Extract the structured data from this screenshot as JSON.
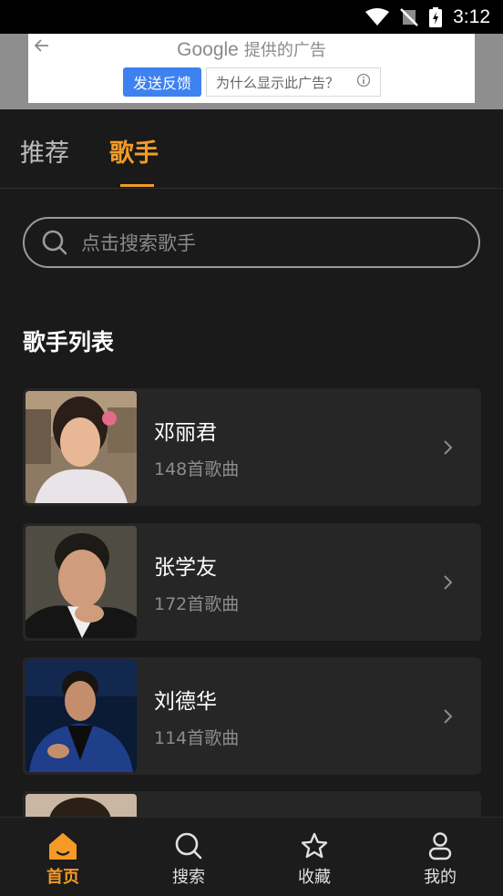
{
  "status_bar": {
    "time": "3:12"
  },
  "ad": {
    "brand": "Google",
    "title_suffix": "提供的广告",
    "feedback_label": "发送反馈",
    "why_label": "为什么显示此广告？"
  },
  "tabs": [
    {
      "label": "推荐",
      "active": false
    },
    {
      "label": "歌手",
      "active": true
    }
  ],
  "search": {
    "placeholder": "点击搜索歌手"
  },
  "section_title": "歌手列表",
  "singers": [
    {
      "name": "邓丽君",
      "count": "148首歌曲"
    },
    {
      "name": "张学友",
      "count": "172首歌曲"
    },
    {
      "name": "刘德华",
      "count": "114首歌曲"
    }
  ],
  "bottom_nav": [
    {
      "label": "首页",
      "icon": "home-icon",
      "active": true
    },
    {
      "label": "搜索",
      "icon": "search-icon",
      "active": false
    },
    {
      "label": "收藏",
      "icon": "star-icon",
      "active": false
    },
    {
      "label": "我的",
      "icon": "user-icon",
      "active": false
    }
  ],
  "colors": {
    "accent": "#f39b26",
    "background": "#1a1a1a",
    "card": "#262626",
    "ad_button": "#3d82f0"
  }
}
